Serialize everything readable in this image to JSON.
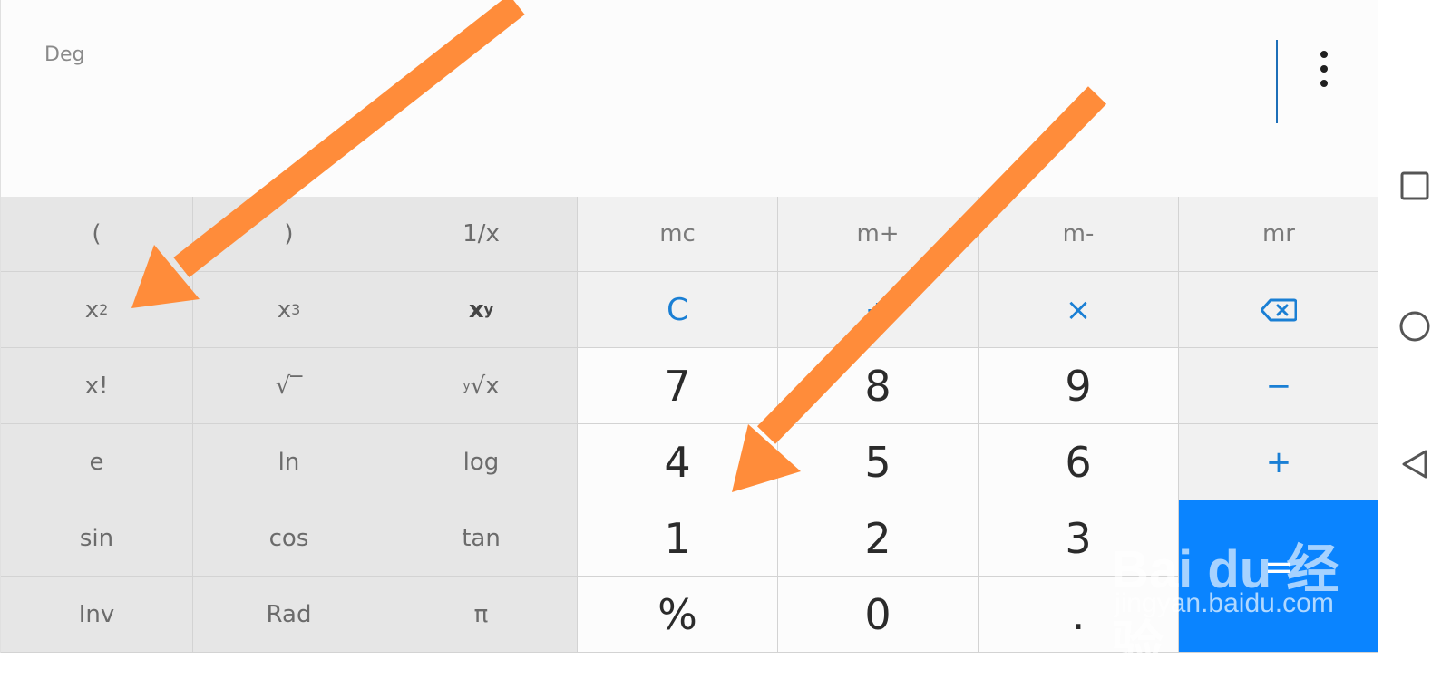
{
  "display": {
    "mode": "Deg"
  },
  "keys": {
    "open_paren": "(",
    "close_paren": ")",
    "reciprocal": "1/x",
    "mc": "mc",
    "m_plus": "m+",
    "m_minus": "m-",
    "mr": "mr",
    "square_base": "x",
    "square_exp": "2",
    "cube_base": "x",
    "cube_exp": "3",
    "power_base": "x",
    "power_exp": "y",
    "clear": "C",
    "divide": "÷",
    "multiply": "×",
    "factorial": "x!",
    "sqrt": "√‾",
    "root_y": "y",
    "root_x": "√x",
    "seven": "7",
    "eight": "8",
    "nine": "9",
    "minus": "−",
    "e": "e",
    "ln": "ln",
    "log": "log",
    "four": "4",
    "five": "5",
    "six": "6",
    "plus": "+",
    "sin": "sin",
    "cos": "cos",
    "tan": "tan",
    "one": "1",
    "two": "2",
    "three": "3",
    "equals": "=",
    "inv": "Inv",
    "rad": "Rad",
    "pi": "π",
    "percent": "%",
    "zero": "0",
    "decimal": "."
  },
  "watermark": {
    "brand": "Bai du 经验",
    "site": "jingyan.baidu.com"
  },
  "colors": {
    "accent": "#1a7fd4",
    "equals_bg": "#0a84ff",
    "arrow": "#ff8c3a"
  },
  "icons": {
    "more": "more-vert-icon",
    "backspace": "backspace-icon",
    "nav": [
      "square-icon",
      "circle-icon",
      "back-triangle-icon"
    ]
  }
}
